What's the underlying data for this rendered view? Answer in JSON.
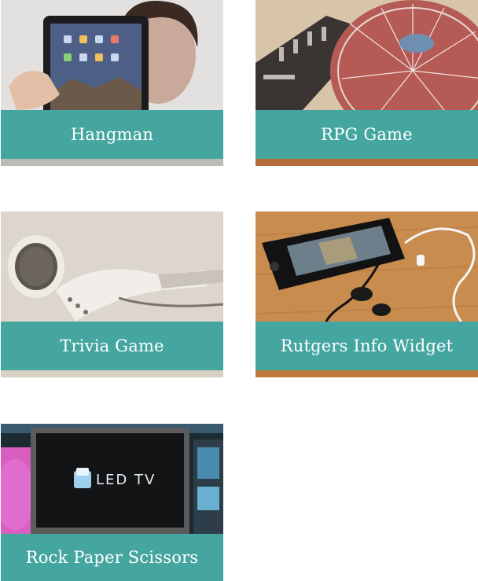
{
  "tiles": [
    {
      "id": "t1",
      "label": "Hangman",
      "image": "person-holding-tablet"
    },
    {
      "id": "t2",
      "label": "RPG Game",
      "image": "dj-turntable"
    },
    {
      "id": "t3",
      "label": "Trivia Game",
      "image": "white-earbuds"
    },
    {
      "id": "t4",
      "label": "Rutgers Info Widget",
      "image": "phone-with-earphones"
    },
    {
      "id": "t5",
      "label": "Rock Paper Scissors",
      "image": "led-tv-display"
    }
  ],
  "colors": {
    "label_bar": "#45a6a0",
    "label_text": "#ffffff",
    "background": "#ffffff"
  }
}
